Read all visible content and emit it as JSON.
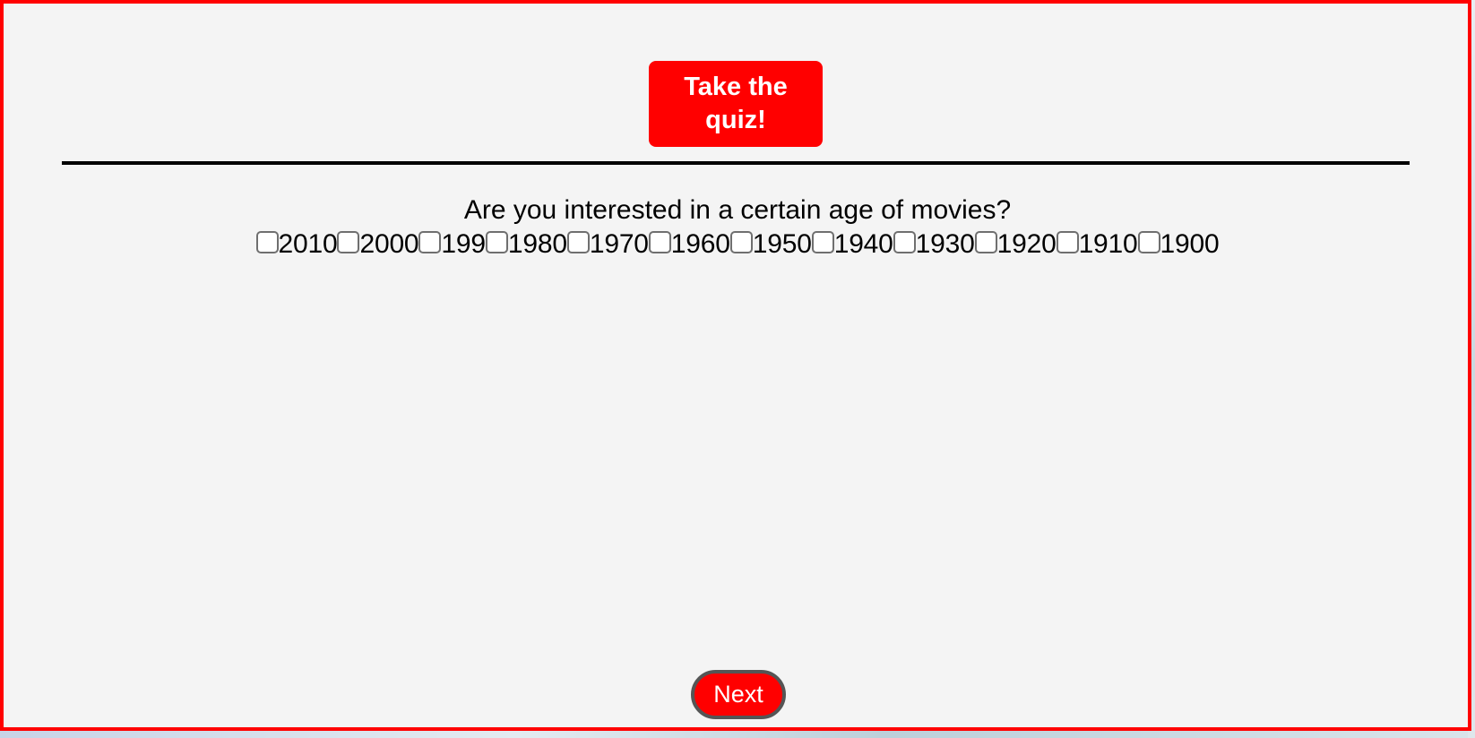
{
  "quiz_button": {
    "label": "Take the quiz!"
  },
  "question": {
    "text": "Are you interested in a certain age of movies?"
  },
  "options": [
    {
      "label": "2010",
      "checked": false
    },
    {
      "label": "2000",
      "checked": false
    },
    {
      "label": "199",
      "checked": false
    },
    {
      "label": "1980",
      "checked": false
    },
    {
      "label": "1970",
      "checked": false
    },
    {
      "label": "1960",
      "checked": false
    },
    {
      "label": "1950",
      "checked": false
    },
    {
      "label": "1940",
      "checked": false
    },
    {
      "label": "1930",
      "checked": false
    },
    {
      "label": "1920",
      "checked": false
    },
    {
      "label": "1910",
      "checked": false
    },
    {
      "label": "1900",
      "checked": false
    }
  ],
  "next_button": {
    "label": "Next"
  },
  "colors": {
    "accent": "#ff0000",
    "frame_border": "#ff0000",
    "background": "#f4f4f4",
    "text": "#000000"
  }
}
